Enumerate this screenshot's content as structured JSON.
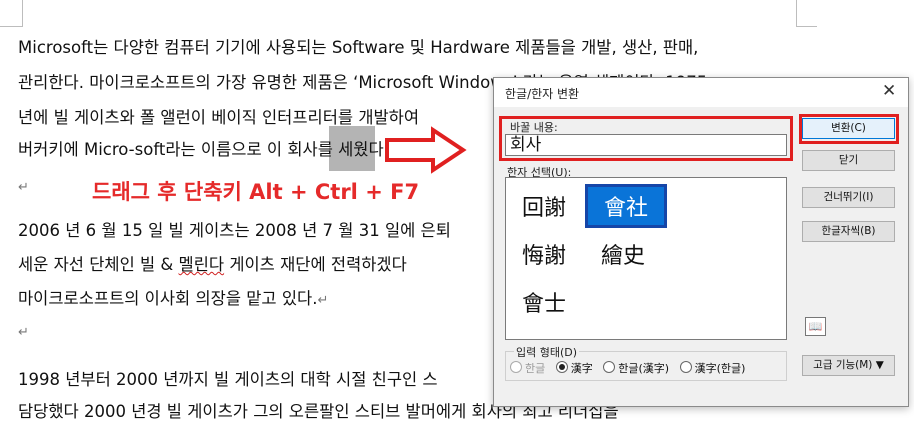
{
  "document": {
    "lines": [
      "Microsoft는 다양한 컴퓨터 기기에 사용되는 Software 및 Hardware 제품들을 개발, 생산, 판매,",
      "관리한다. 마이크로소프트의 가장 유명한 제품은 ‘Microsoft Windows’ 라는 운영 체제이다. 1975",
      "년에 빌 게이츠와 폴 앨런이 베이직 인터프리터를 개발하여",
      "버커키에 Micro-soft라는 이름으로 이 ",
      "회사",
      "를 세웠다.",
      "2006 년 6 월 15 일 빌 게이츠는 2008 년 7 월 31 일에 은퇴",
      "세운 자선 단체인 빌 & ",
      "멜린다",
      " 게이츠 재단에 전력하겠다",
      "마이크로소프트의 이사회 의장을 맡고 있다.",
      "1998 년부터 2000 년까지 빌 게이츠의 대학 시절 친구인 스",
      "담당했다 2000 년경 빌 게이츠가 그의 오른팔인 스티브 발머에게 회사의 최고 리더십을"
    ],
    "para_mark": "↵",
    "annotation": "드래그 후 단축키 Alt + Ctrl + F7"
  },
  "dialog": {
    "title": "한글/한자 변환",
    "close_glyph": "✕",
    "original_label": "바꿀 내용:",
    "original_value": "회사",
    "candidates_label": "한자 선택(U):",
    "candidates": [
      "回謝",
      "會社",
      "悔謝",
      "繪史",
      "會士"
    ],
    "selected_candidate": "會社",
    "buttons": {
      "convert": "변환(C)",
      "close": "닫기",
      "skip": "건너뛰기(I)",
      "dictionary": "한글자씩(B)",
      "advanced": "고급 기능(M) ▼"
    },
    "input_form_label": "입력 형태(D)",
    "input_forms": [
      "한글",
      "漢字",
      "한글(漢字)",
      "漢字(한글)"
    ],
    "selected_input_form": "漢字",
    "book_icon": "📖"
  },
  "colors": {
    "accent_red": "#e02020",
    "selection_blue": "#0a74d8"
  }
}
